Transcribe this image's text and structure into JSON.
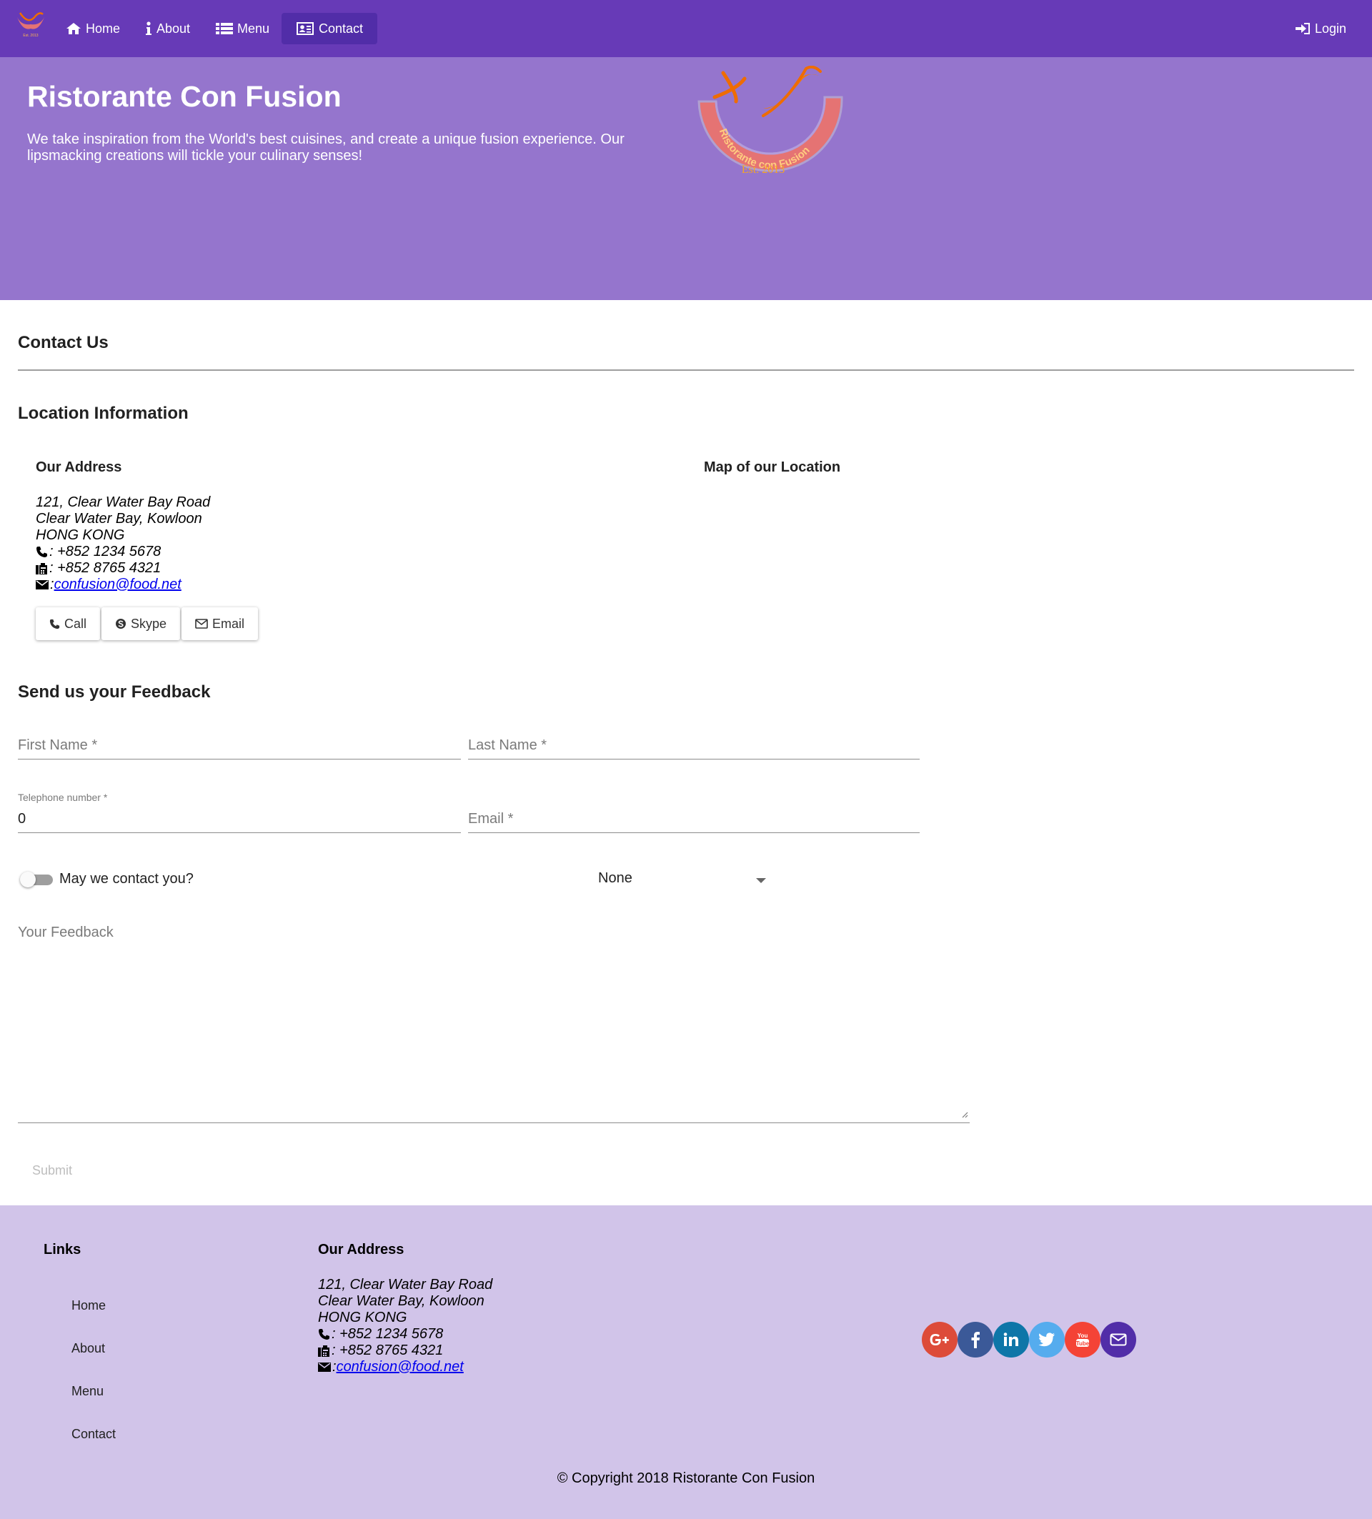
{
  "nav": {
    "items": [
      {
        "label": "Home",
        "icon": "home-icon"
      },
      {
        "label": "About",
        "icon": "info-icon"
      },
      {
        "label": "Menu",
        "icon": "list-icon"
      },
      {
        "label": "Contact",
        "icon": "address-card-icon"
      }
    ],
    "login": "Login"
  },
  "hero": {
    "title": "Ristorante Con Fusion",
    "text": "We take inspiration from the World's best cuisines, and create a unique fusion experience. Our lipsmacking creations will tickle your culinary senses!",
    "logo_text": "Ristorante con Fusion",
    "logo_est": "Est. 2013"
  },
  "contact": {
    "title": "Contact Us",
    "location_title": "Location Information",
    "address_title": "Our Address",
    "map_title": "Map of our Location",
    "address": {
      "line1": "121, Clear Water Bay Road",
      "line2": "Clear Water Bay, Kowloon",
      "line3": "HONG KONG",
      "phone": ": +852 1234 5678",
      "fax": ": +852 8765 4321",
      "email_sep": ": ",
      "email": "confusion@food.net"
    },
    "buttons": {
      "call": "Call",
      "skype": "Skype",
      "email": "Email"
    }
  },
  "feedback": {
    "title": "Send us your Feedback",
    "first_name": "First Name *",
    "last_name": "Last Name *",
    "telephone_label": "Telephone number *",
    "telephone_value": "0",
    "email": "Email *",
    "contact_toggle": "May we contact you?",
    "contact_toggle_on": false,
    "contact_type": "None",
    "message": "Your Feedback",
    "submit": "Submit"
  },
  "footer": {
    "links_title": "Links",
    "links": [
      "Home",
      "About",
      "Menu",
      "Contact"
    ],
    "address_title": "Our Address",
    "social": [
      "google-plus-icon",
      "facebook-icon",
      "linkedin-icon",
      "twitter-icon",
      "youtube-icon",
      "envelope-icon"
    ],
    "copyright": "© Copyright 2018 Ristorante Con Fusion"
  },
  "colors": {
    "primary": "#673ab7",
    "primary_dark": "#512da8",
    "hero": "#9575cd",
    "footer": "#d1c4e9",
    "google": "#dd4b39",
    "facebook": "#3b5998",
    "linkedin": "#0e76a8",
    "twitter": "#55acee",
    "youtube": "#f44336",
    "mail": "#512da8"
  }
}
